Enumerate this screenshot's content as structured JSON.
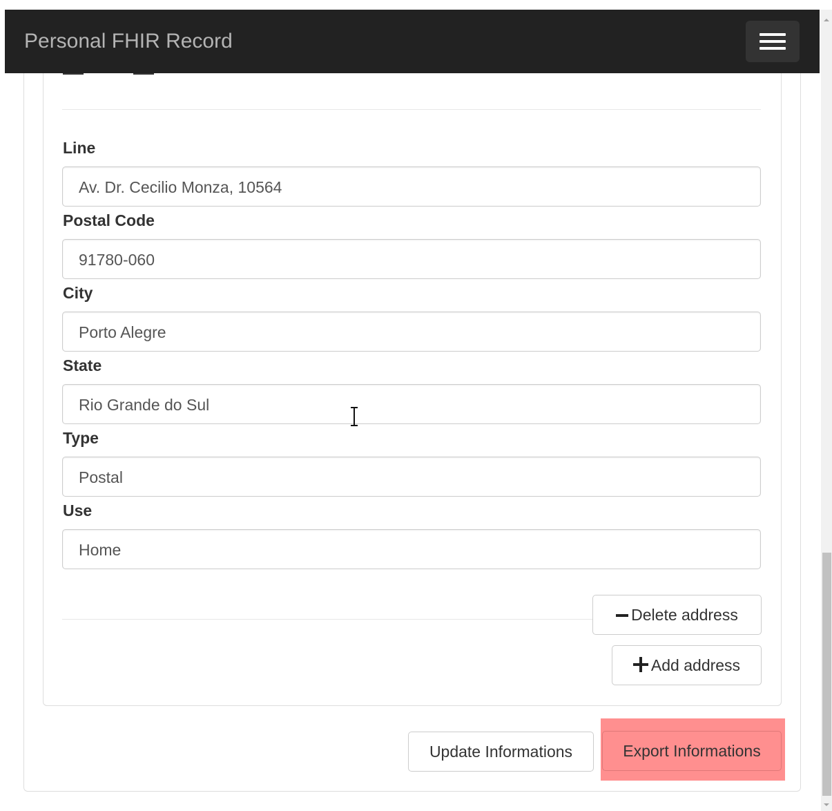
{
  "navbar": {
    "brand": "Personal FHIR Record",
    "menu_icon": "hamburger-icon"
  },
  "address_form": {
    "fields": [
      {
        "label": "Line",
        "value": "Av. Dr. Cecilio Monza, 10564"
      },
      {
        "label": "Postal Code",
        "value": "91780-060"
      },
      {
        "label": "City",
        "value": "Porto Alegre"
      },
      {
        "label": "State",
        "value": "Rio Grande do Sul"
      },
      {
        "label": "Type",
        "value": "Postal"
      },
      {
        "label": "Use",
        "value": "Home"
      }
    ],
    "delete_label": "Delete address",
    "delete_icon": "minus-icon",
    "add_label": "Add address",
    "add_icon": "plus-icon"
  },
  "actions": {
    "update_label": "Update Informations",
    "export_label": "Export Informations"
  },
  "colors": {
    "navbar": "#222222",
    "highlight": "#ff8f8f"
  }
}
